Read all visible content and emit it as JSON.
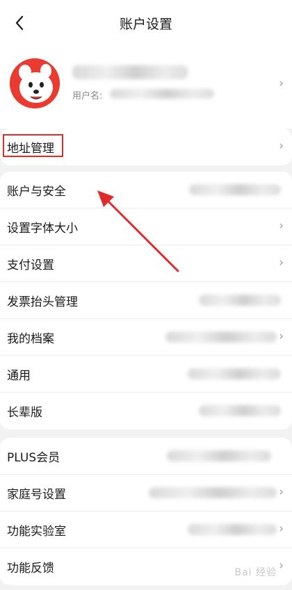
{
  "header": {
    "title": "账户设置",
    "back_icon": "chevron-left-icon"
  },
  "profile": {
    "username_label": "用户名:",
    "avatar_icon": "jd-mascot-avatar"
  },
  "address_card": {
    "items": [
      {
        "label": "地址管理"
      }
    ]
  },
  "settings_card": {
    "items": [
      {
        "label": "账户与安全"
      },
      {
        "label": "设置字体大小"
      },
      {
        "label": "支付设置"
      },
      {
        "label": "发票抬头管理"
      },
      {
        "label": "我的档案"
      },
      {
        "label": "通用"
      },
      {
        "label": "长辈版"
      }
    ]
  },
  "plus_card": {
    "items": [
      {
        "label": "PLUS会员"
      },
      {
        "label": "家庭号设置"
      },
      {
        "label": "功能实验室"
      },
      {
        "label": "功能反馈"
      }
    ]
  },
  "annotation": {
    "highlight_color": "#e02b2b"
  },
  "watermark": {
    "text": "Bai 经验"
  },
  "colors": {
    "accent": "#e93b2f",
    "background": "#f2f2f2"
  }
}
